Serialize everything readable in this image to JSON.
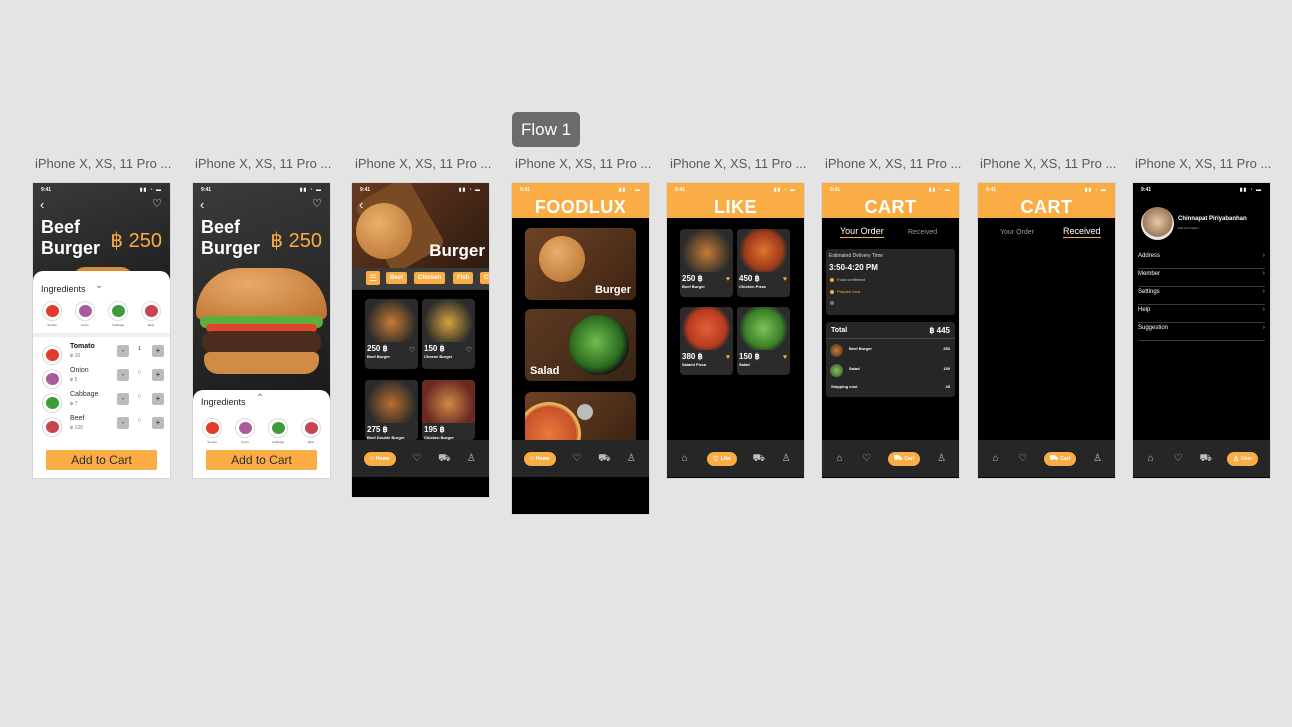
{
  "flow": "Flow 1",
  "frame_label": "iPhone X, XS, 11 Pro ...",
  "status_time": "9:41",
  "product": {
    "name_line1": "Beef",
    "name_line2": "Burger",
    "price": "฿ 250",
    "ingredients_title": "Ingredients",
    "ingredient_names": [
      "Tomato",
      "Onion",
      "Cabbage",
      "Beef"
    ],
    "ingredient_prices": [
      "฿ 10",
      "฿ 5",
      "฿ 7",
      "฿ 120"
    ],
    "quantities": [
      "1",
      "0",
      "0",
      "0"
    ],
    "add_to_cart": "Add to Cart",
    "minus": "-",
    "plus": "+"
  },
  "burger_page": {
    "title": "Burger",
    "filters": [
      "Beef",
      "Chicken",
      "Fish",
      "Ch"
    ],
    "items": [
      {
        "price": "250 ฿",
        "name": "Beef Burger"
      },
      {
        "price": "150 ฿",
        "name": "Cheese Burger"
      },
      {
        "price": "275 ฿",
        "name": "Beef Double Burger"
      },
      {
        "price": "195 ฿",
        "name": "Chicken Burger"
      }
    ]
  },
  "foodlux": {
    "title": "FOODLUX",
    "categories": [
      "Burger",
      "Salad"
    ]
  },
  "like": {
    "title": "LIKE",
    "items": [
      {
        "price": "250 ฿",
        "name": "Beef Burger"
      },
      {
        "price": "450 ฿",
        "name": "Chicken Pizza"
      },
      {
        "price": "380 ฿",
        "name": "Salami Pizza"
      },
      {
        "price": "150 ฿",
        "name": "Salad"
      }
    ]
  },
  "cart": {
    "title": "CART",
    "tab_order": "Your Order",
    "tab_received": "Received",
    "eta_label": "Estimated Delivery Time",
    "eta_value": "3:50-4:20 PM",
    "steps": [
      "Food confirmed",
      "Prepare food"
    ],
    "total_label": "Total",
    "total_value": "฿ 445",
    "lines": [
      {
        "name": "Beef Burger",
        "value": "250"
      },
      {
        "name": "Salad",
        "value": "150"
      },
      {
        "name": "Shipping cost",
        "value": "45"
      }
    ]
  },
  "profile": {
    "name": "Chinnapat Piriyabanhan",
    "sub": "Edit information",
    "menu": [
      "Address",
      "Member",
      "Settings",
      "Help",
      "Suggestion"
    ]
  },
  "nav": {
    "home": "Home",
    "like": "Like",
    "cart": "Cart",
    "user": "User"
  },
  "colors": {
    "accent": "#f9ad44",
    "dark": "#000000",
    "card": "#2b2b2b",
    "nav": "#262626"
  }
}
